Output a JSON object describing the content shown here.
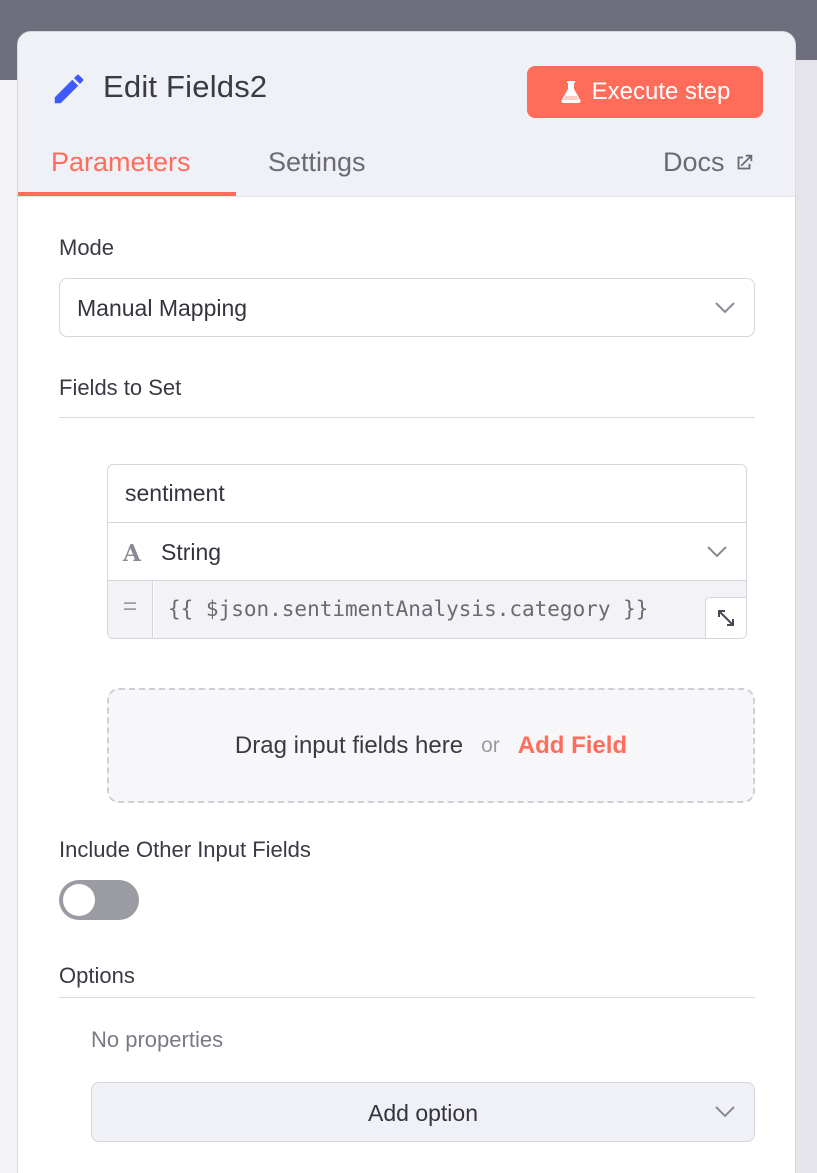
{
  "header": {
    "title": "Edit Fields2",
    "execute_label": "Execute step"
  },
  "tabs": [
    {
      "label": "Parameters",
      "active": true
    },
    {
      "label": "Settings",
      "active": false
    }
  ],
  "docs_label": "Docs",
  "mode": {
    "label": "Mode",
    "value": "Manual Mapping"
  },
  "fields_to_set": {
    "label": "Fields to Set",
    "field": {
      "name": "sentiment",
      "type": "String",
      "operator": "=",
      "value": "{{ $json.sentimentAnalysis.category }}"
    },
    "dropzone": {
      "text": "Drag input fields here",
      "or": "or",
      "add_label": "Add Field"
    }
  },
  "include_other": {
    "label": "Include Other Input Fields",
    "enabled": false
  },
  "options": {
    "label": "Options",
    "empty_text": "No properties",
    "add_label": "Add option"
  },
  "colors": {
    "accent": "#ff6d5a",
    "title_icon": "#3d5afe",
    "toggle_off": "#9b9ba3"
  },
  "icons": {
    "title": "pencil-icon",
    "execute": "flask-icon",
    "docs": "external-link-icon",
    "type": "string-type-icon",
    "expand": "expand-icon",
    "dropdown": "chevron-down-icon"
  }
}
